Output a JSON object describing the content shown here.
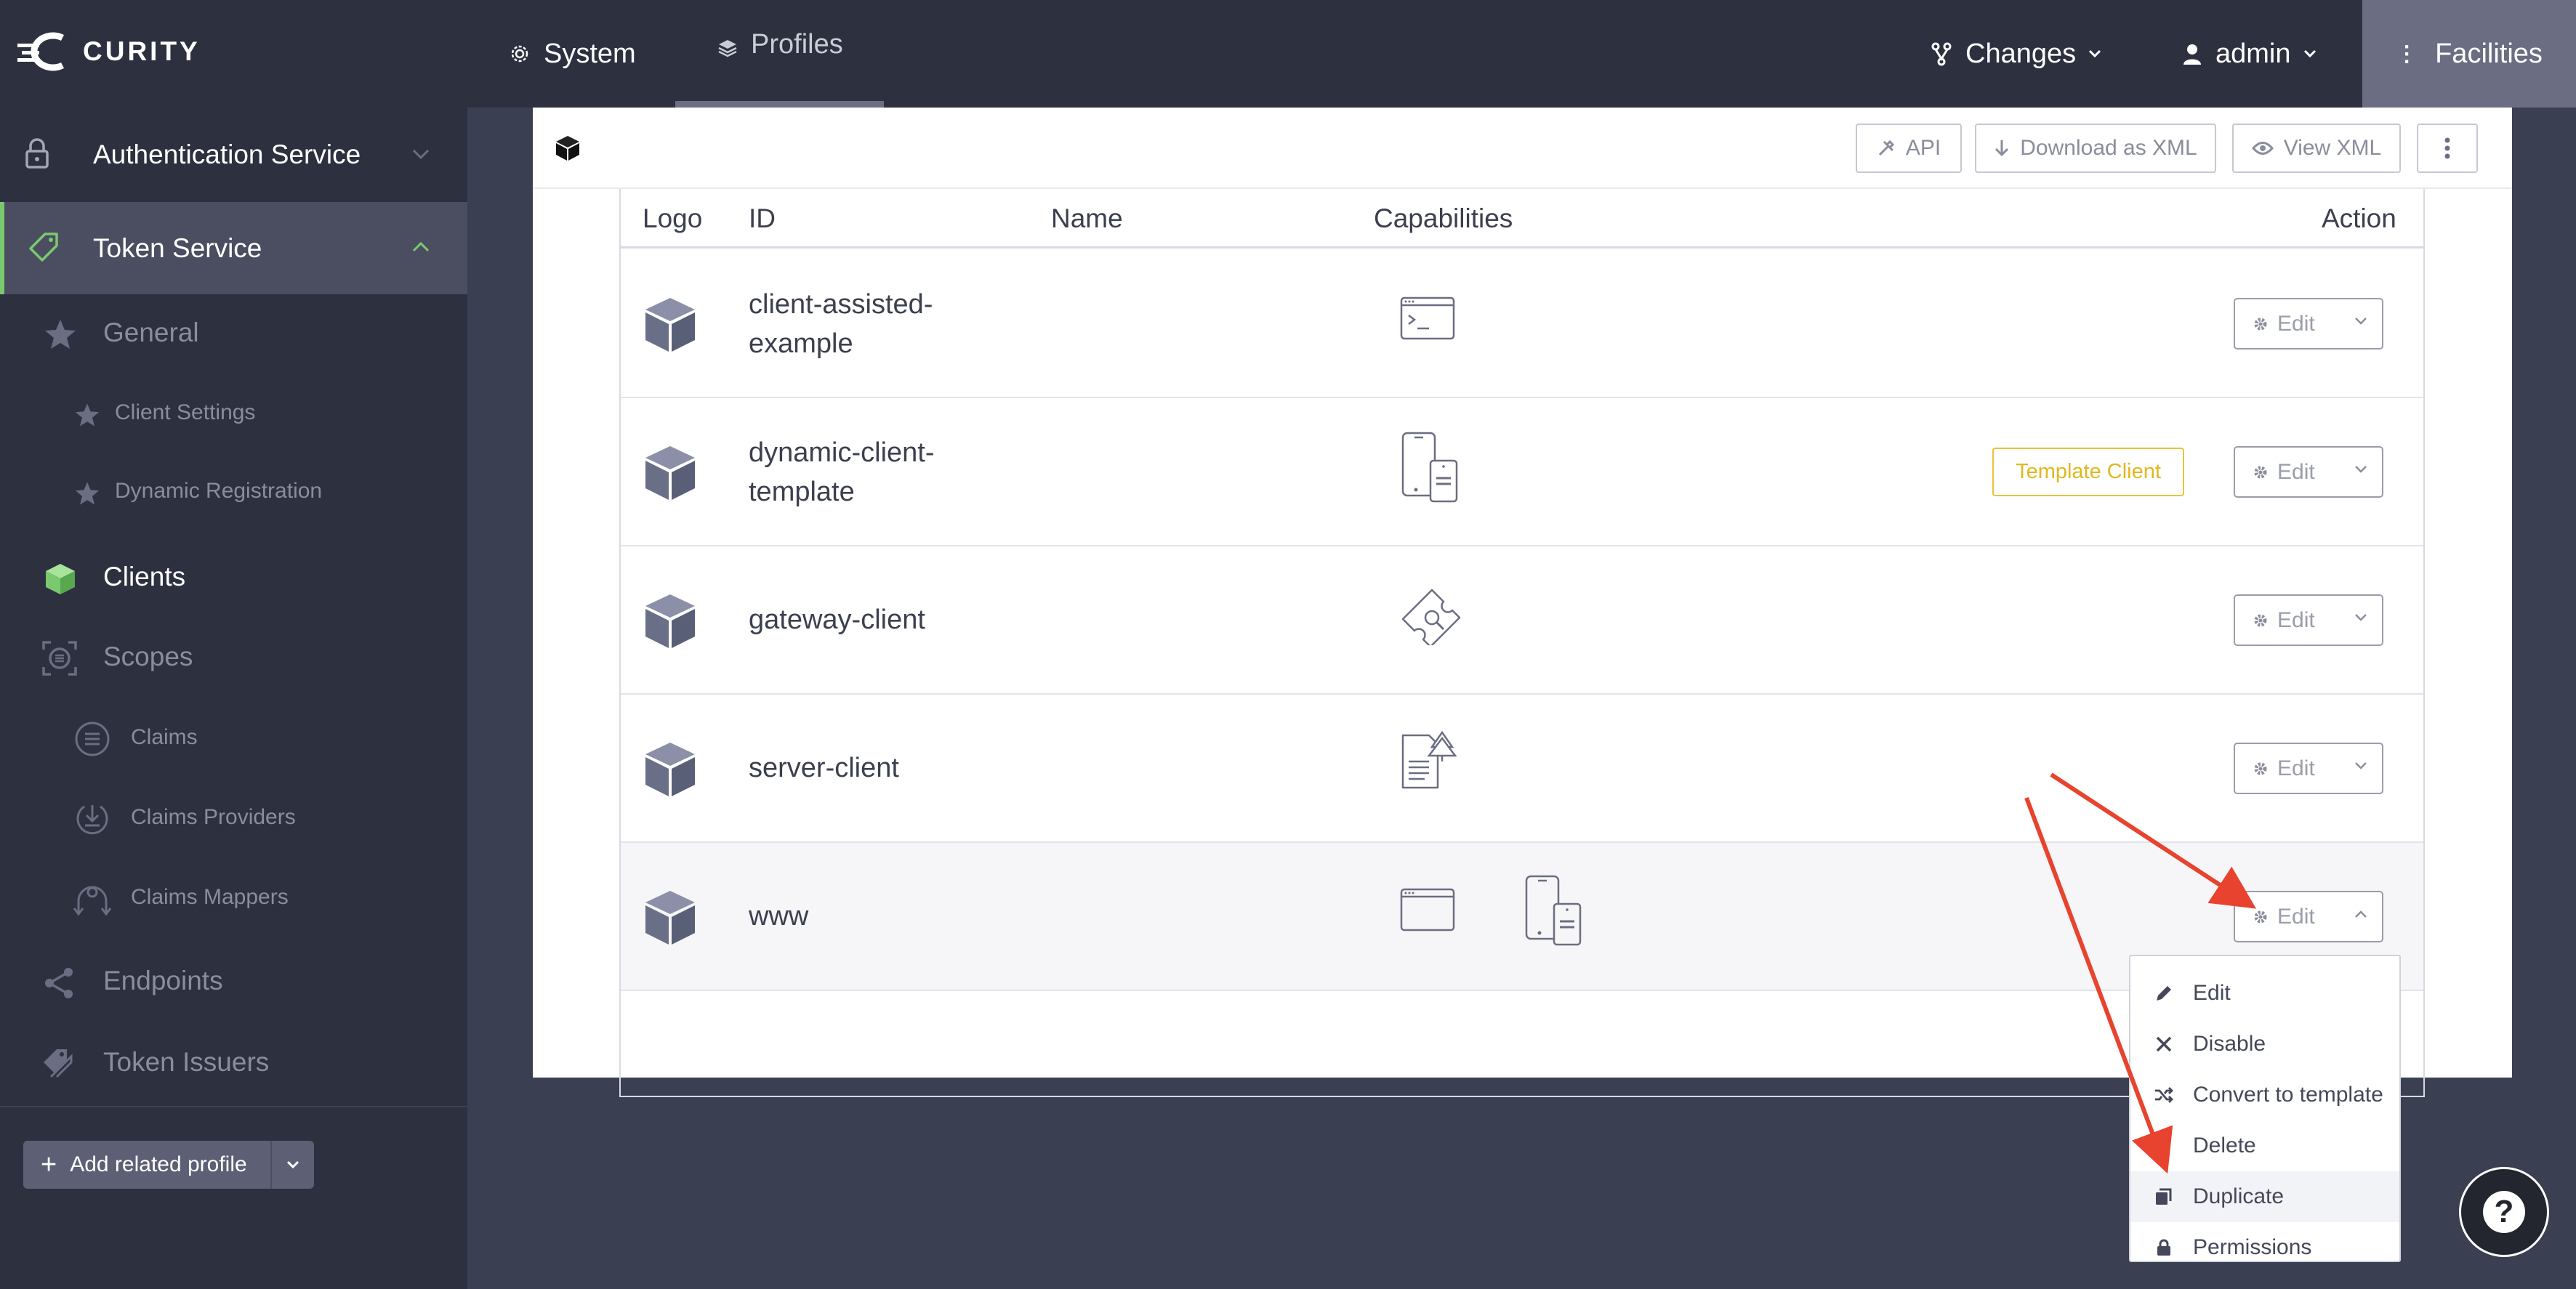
{
  "app": {
    "brand": "CURITY"
  },
  "topnav": {
    "system": "System",
    "profiles": "Profiles",
    "changes": "Changes",
    "user": "admin",
    "facilities": "Facilities"
  },
  "sidebar": {
    "items": [
      {
        "label": "Authentication Service",
        "icon": "lock-icon"
      },
      {
        "label": "Token Service",
        "icon": "tag-icon"
      },
      {
        "label": "General",
        "icon": "star-icon"
      },
      {
        "label": "Client Settings",
        "icon": "star-icon"
      },
      {
        "label": "Dynamic Registration",
        "icon": "star-icon"
      },
      {
        "label": "Clients",
        "icon": "cube-icon"
      },
      {
        "label": "Scopes",
        "icon": "scopes-icon"
      },
      {
        "label": "Claims",
        "icon": "list-circle-icon"
      },
      {
        "label": "Claims Providers",
        "icon": "download-circle-icon"
      },
      {
        "label": "Claims Mappers",
        "icon": "mapper-icon"
      },
      {
        "label": "Endpoints",
        "icon": "share-icon"
      },
      {
        "label": "Token Issuers",
        "icon": "tags-icon"
      }
    ],
    "add_related": "Add related profile"
  },
  "toolbar": {
    "api": "API",
    "download": "Download as XML",
    "view": "View XML"
  },
  "table": {
    "headers": {
      "logo": "Logo",
      "id": "ID",
      "name": "Name",
      "capabilities": "Capabilities",
      "action": "Action"
    },
    "rows": [
      {
        "id_line1": "client-assisted-",
        "id_line2": "example",
        "caps": [
          "terminal-window-icon"
        ],
        "badge": ""
      },
      {
        "id_line1": "dynamic-client-",
        "id_line2": "template",
        "caps": [
          "mobile-devices-icon"
        ],
        "badge": "Template Client"
      },
      {
        "id_line1": "gateway-client",
        "id_line2": "",
        "caps": [
          "ticket-search-icon"
        ],
        "badge": ""
      },
      {
        "id_line1": "server-client",
        "id_line2": "",
        "caps": [
          "document-tree-icon"
        ],
        "badge": ""
      },
      {
        "id_line1": "www",
        "id_line2": "",
        "caps": [
          "browser-window-icon",
          "mobile-devices-icon"
        ],
        "badge": ""
      }
    ],
    "edit_label": "Edit"
  },
  "menu": {
    "items": [
      {
        "label": "Edit",
        "icon": "pencil-icon"
      },
      {
        "label": "Disable",
        "icon": "x-icon"
      },
      {
        "label": "Convert to template",
        "icon": "shuffle-icon"
      },
      {
        "label": "Delete",
        "icon": "trash-icon"
      },
      {
        "label": "Duplicate",
        "icon": "copy-icon"
      },
      {
        "label": "Permissions",
        "icon": "lock-icon"
      }
    ]
  },
  "help": {
    "label": "?"
  },
  "colors": {
    "accent_green": "#7bc96f",
    "badge_yellow": "#e0b81f",
    "arrow_red": "#e8432e",
    "nav_bg": "#2d303f"
  }
}
